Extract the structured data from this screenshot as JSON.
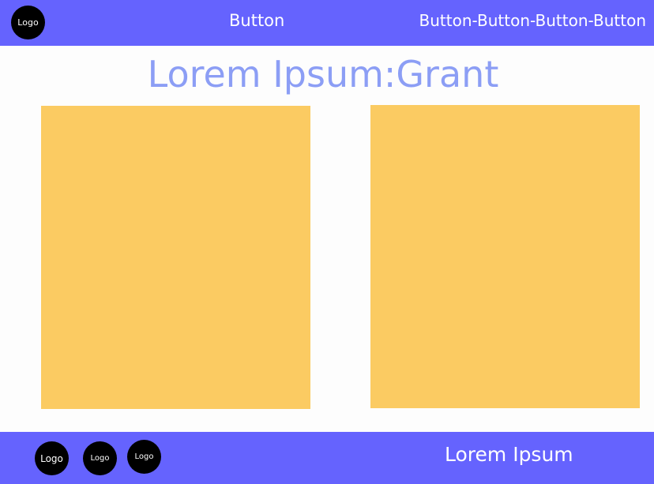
{
  "header": {
    "logo": "Logo",
    "center_button": "Button",
    "right_button": "Button-Button-Button-Button"
  },
  "main": {
    "title": "Lorem Ipsum:Grant"
  },
  "footer": {
    "logos": [
      "Logo",
      "Logo",
      "Logo"
    ],
    "text": "Lorem Ipsum"
  },
  "colors": {
    "bar": "#6563fe",
    "title": "#8c9ef5",
    "card": "#fbcb62",
    "background": "#fdfdfd",
    "logo": "#000000"
  }
}
